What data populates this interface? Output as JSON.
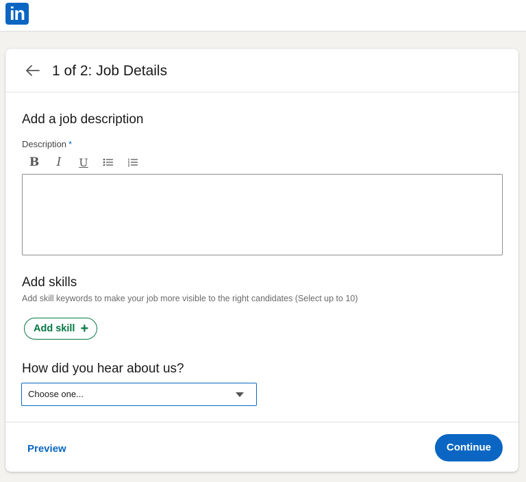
{
  "brand": {
    "logo_text": "in",
    "logo_color": "#0a66c2"
  },
  "header": {
    "back_icon": "arrow-left-icon",
    "title": "1 of 2: Job Details"
  },
  "description_section": {
    "title": "Add a job description",
    "field_label": "Description",
    "required_mark": "*",
    "toolbar": [
      {
        "name": "bold",
        "glyph": "B"
      },
      {
        "name": "italic",
        "glyph": "I"
      },
      {
        "name": "underline",
        "glyph": "U"
      },
      {
        "name": "bulleted-list",
        "glyph": "bullet-list-icon"
      },
      {
        "name": "numbered-list",
        "glyph": "numbered-list-icon"
      }
    ],
    "editor_value": ""
  },
  "skills_section": {
    "title": "Add skills",
    "help_text": "Add skill keywords to make your job more visible to the right candidates (Select up to 10)",
    "add_button_label": "Add skill",
    "add_button_icon": "plus-icon",
    "accent_color": "#057642"
  },
  "referral_section": {
    "title": "How did you hear about us?",
    "selected_value": "Choose one...",
    "caret_icon": "caret-down-icon"
  },
  "footer": {
    "preview_label": "Preview",
    "continue_label": "Continue"
  }
}
